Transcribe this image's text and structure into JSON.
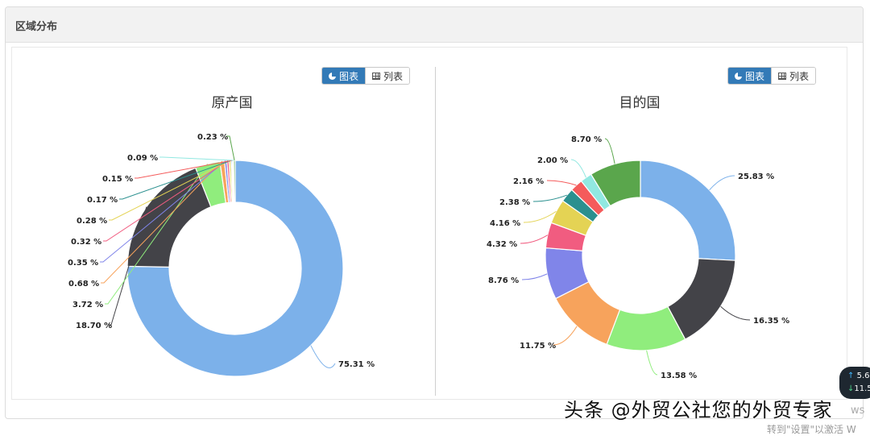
{
  "panel": {
    "title": "区域分布"
  },
  "left": {
    "toggle": {
      "chart_label": "图表",
      "list_label": "列表"
    }
  },
  "right": {
    "toggle": {
      "chart_label": "图表",
      "list_label": "列表"
    }
  },
  "chart_data": [
    {
      "type": "pie",
      "title": "原产国",
      "donut": true,
      "slices": [
        {
          "value": 75.31,
          "label": "75.31 %",
          "color": "#7cb1ea"
        },
        {
          "value": 18.7,
          "label": "18.70 %",
          "color": "#434348"
        },
        {
          "value": 3.72,
          "label": "3.72 %",
          "color": "#90ed7d"
        },
        {
          "value": 0.68,
          "label": "0.68 %",
          "color": "#f7a35c"
        },
        {
          "value": 0.35,
          "label": "0.35 %",
          "color": "#8085e9"
        },
        {
          "value": 0.32,
          "label": "0.32 %",
          "color": "#f15c80"
        },
        {
          "value": 0.28,
          "label": "0.28 %",
          "color": "#e4d354"
        },
        {
          "value": 0.17,
          "label": "0.17 %",
          "color": "#2b908f"
        },
        {
          "value": 0.15,
          "label": "0.15 %",
          "color": "#f45b5b"
        },
        {
          "value": 0.09,
          "label": "0.09 %",
          "color": "#91e8e1"
        },
        {
          "value": 0.23,
          "label": "0.23 %",
          "color": "#5aa64c"
        }
      ]
    },
    {
      "type": "pie",
      "title": "目的国",
      "donut": true,
      "slices": [
        {
          "value": 25.83,
          "label": "25.83 %",
          "color": "#7cb1ea"
        },
        {
          "value": 16.35,
          "label": "16.35 %",
          "color": "#434348"
        },
        {
          "value": 13.58,
          "label": "13.58 %",
          "color": "#90ed7d"
        },
        {
          "value": 11.75,
          "label": "11.75 %",
          "color": "#f7a35c"
        },
        {
          "value": 8.76,
          "label": "8.76 %",
          "color": "#8085e9"
        },
        {
          "value": 4.32,
          "label": "4.32 %",
          "color": "#f15c80"
        },
        {
          "value": 4.16,
          "label": "4.16 %",
          "color": "#e4d354"
        },
        {
          "value": 2.38,
          "label": "2.38 %",
          "color": "#2b908f"
        },
        {
          "value": 2.16,
          "label": "2.16 %",
          "color": "#f45b5b"
        },
        {
          "value": 2.0,
          "label": "2.00 %",
          "color": "#91e8e1"
        },
        {
          "value": 8.7,
          "label": "8.70 %",
          "color": "#5aa64c"
        }
      ]
    }
  ],
  "stock_widget": {
    "up_value": "5.6",
    "down_value": "11.5",
    "up_arrow": "↑",
    "down_arrow": "↓"
  },
  "watermark": {
    "text": "头条 @外贸公社您的外贸专家"
  },
  "activation_hint": {
    "text": "转到\"设置\"以激活 W",
    "ws": "ws"
  }
}
